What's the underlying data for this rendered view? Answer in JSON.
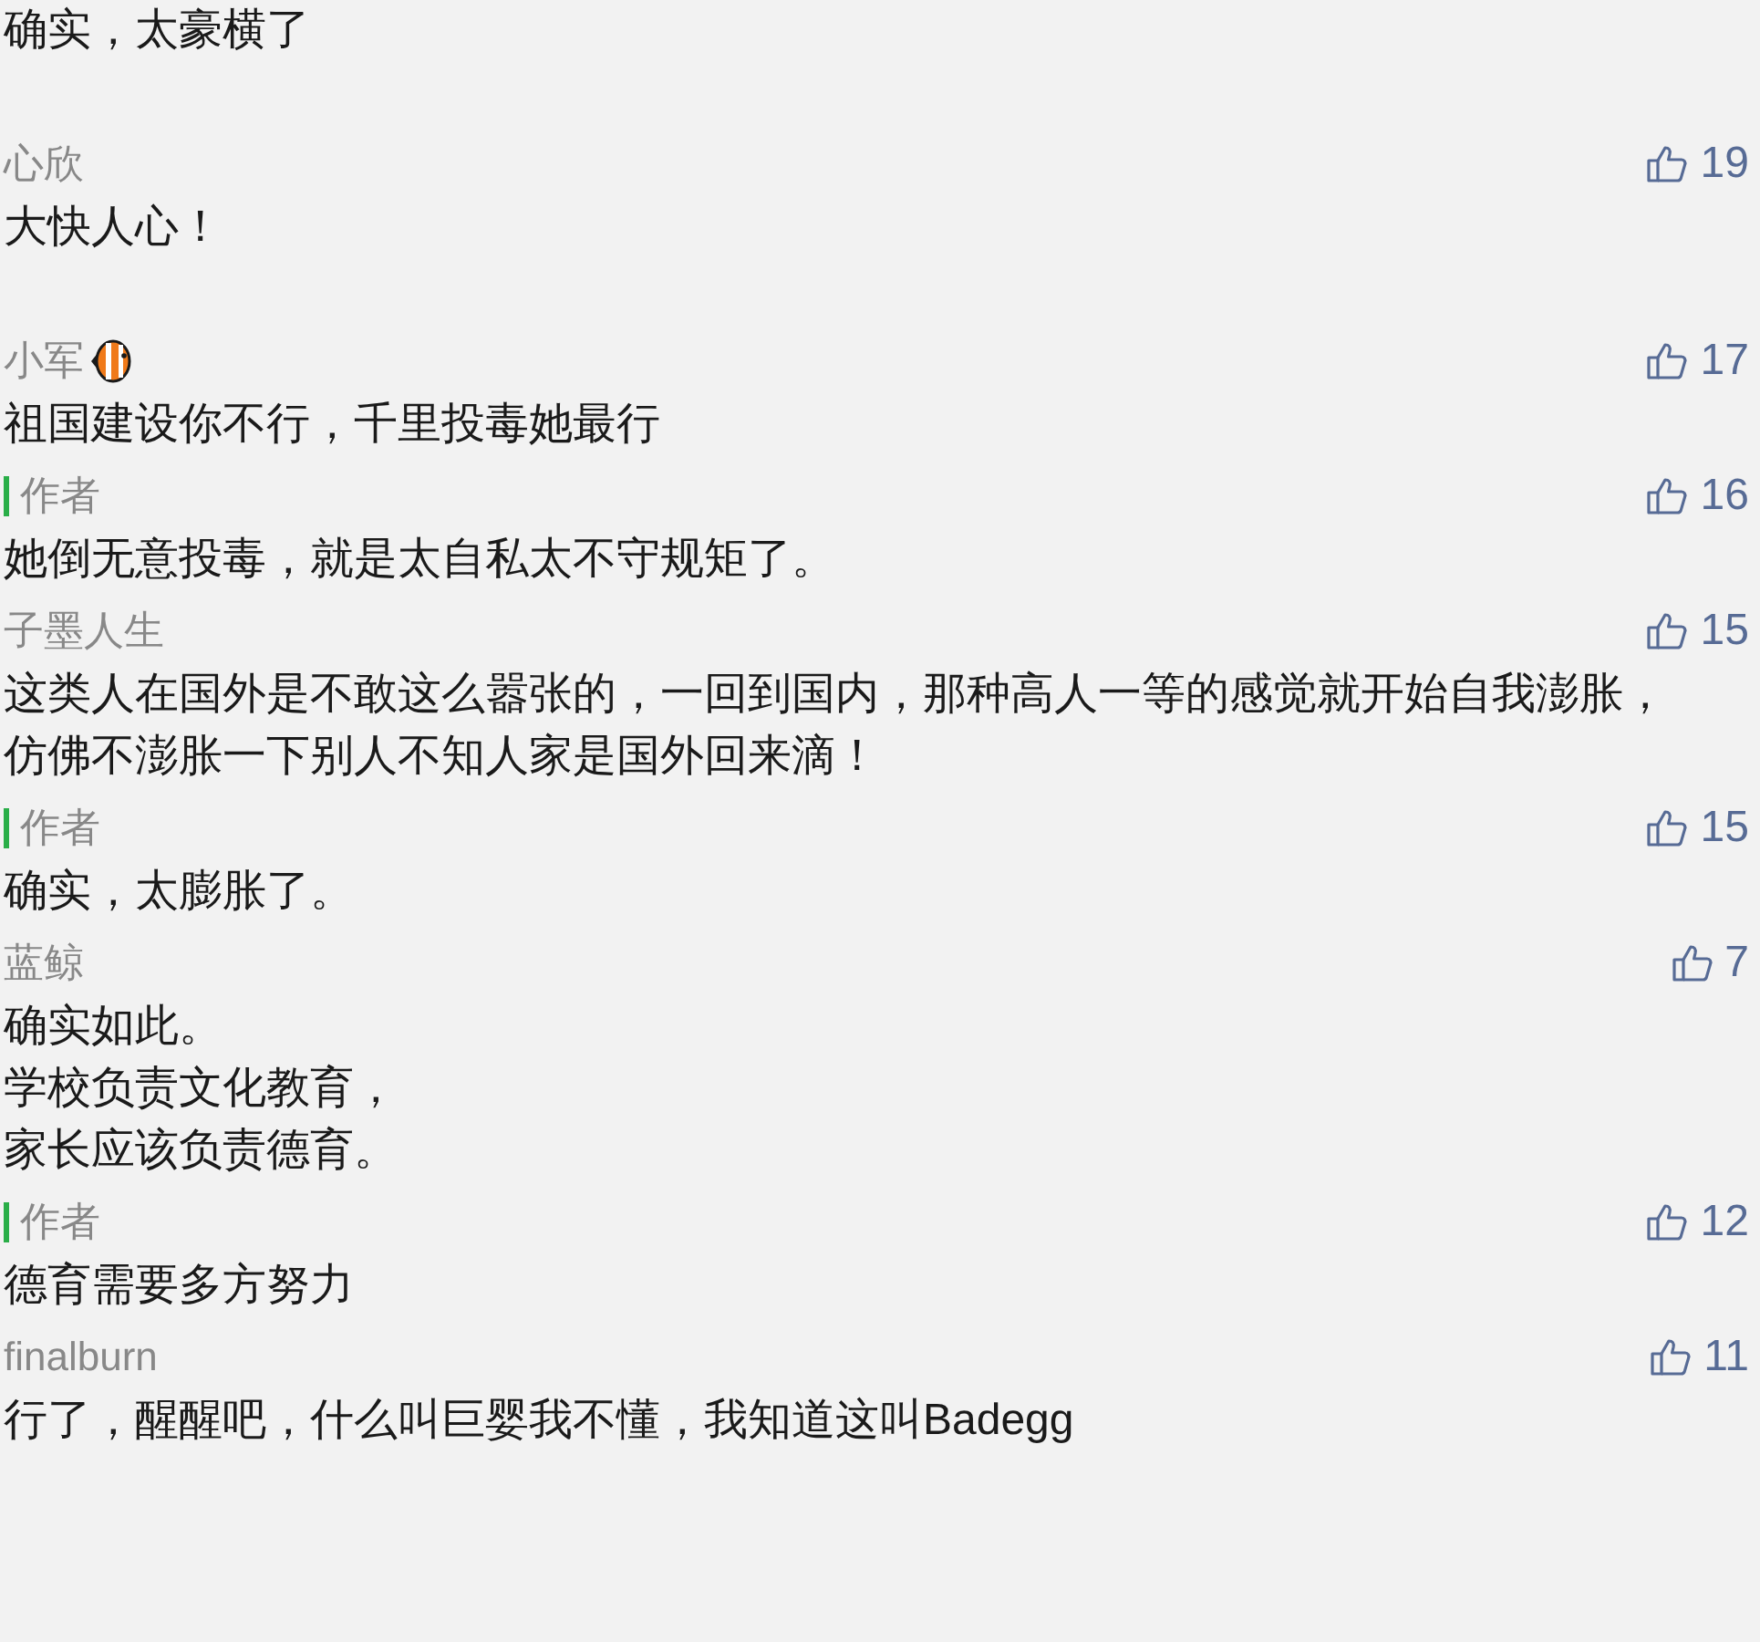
{
  "comments": [
    {
      "kind": "fragment",
      "lines": [
        "确实，太豪横了"
      ]
    },
    {
      "kind": "comment",
      "name": "心欣",
      "badge": false,
      "likes": "19",
      "lines": [
        "大快人心！"
      ]
    },
    {
      "kind": "comment",
      "name": "小军",
      "badge": true,
      "likes": "17",
      "lines": [
        "祖国建设你不行，千里投毒她最行"
      ]
    },
    {
      "kind": "reply",
      "name": "作者",
      "badge": false,
      "likes": "16",
      "lines": [
        "她倒无意投毒，就是太自私太不守规矩了。"
      ]
    },
    {
      "kind": "comment",
      "name": "子墨人生",
      "badge": false,
      "likes": "15",
      "lines": [
        "这类人在国外是不敢这么嚣张的，一回到国内，那种高人一等的感觉就开始自我澎胀，",
        "仿佛不澎胀一下别人不知人家是国外回来滴！"
      ]
    },
    {
      "kind": "reply",
      "name": "作者",
      "badge": false,
      "likes": "15",
      "lines": [
        "确实，太膨胀了。"
      ]
    },
    {
      "kind": "comment",
      "name": "蓝鲸",
      "badge": false,
      "likes": "7",
      "lines": [
        "确实如此。",
        "学校负责文化教育，",
        "家长应该负责德育。"
      ]
    },
    {
      "kind": "reply",
      "name": "作者",
      "badge": false,
      "likes": "12",
      "lines": [
        "德育需要多方努力"
      ]
    },
    {
      "kind": "comment",
      "name": "finalburn",
      "badge": false,
      "likes": "11",
      "lines": [
        "行了，醒醒吧，什么叫巨婴我不懂，我知道这叫Badegg"
      ]
    }
  ]
}
